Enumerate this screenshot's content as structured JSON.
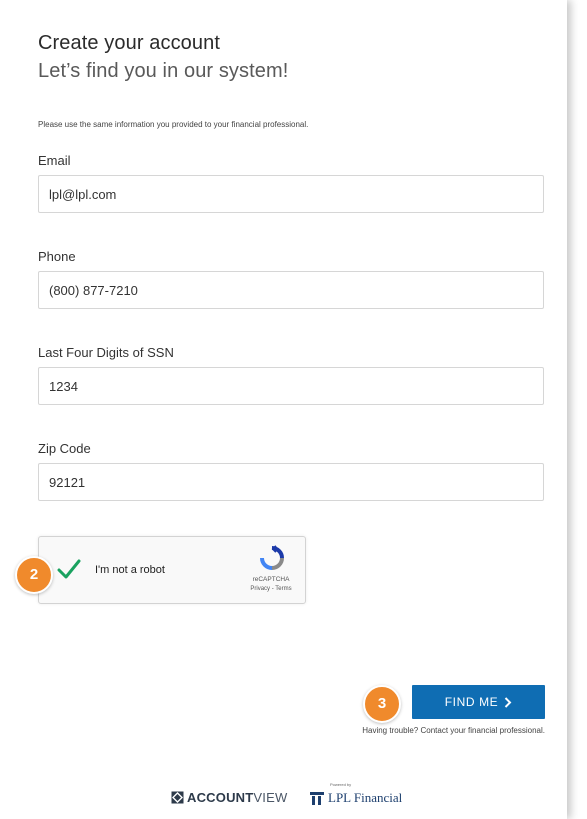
{
  "header": {
    "title": "Create your account",
    "subtitle": "Let’s find you in our system!",
    "instructions": "Please use the same information you provided to your financial professional."
  },
  "form": {
    "email": {
      "label": "Email",
      "value": "lpl@lpl.com"
    },
    "phone": {
      "label": "Phone",
      "value": "(800) 877-7210"
    },
    "ssn": {
      "label": "Last Four Digits of SSN",
      "value": "1234"
    },
    "zip": {
      "label": "Zip Code",
      "value": "92121"
    }
  },
  "recaptcha": {
    "label": "I'm not a robot",
    "checked": true,
    "brand": "reCAPTCHA",
    "terms": "Privacy - Terms"
  },
  "steps": {
    "recaptcha_step": "2",
    "submit_step": "3"
  },
  "actions": {
    "find_me_label": "FIND ME",
    "trouble_text": "Having trouble? Contact your financial professional."
  },
  "footer": {
    "accountview_bold": "ACCOUNT",
    "accountview_light": "VIEW",
    "powered_by": "Powered by",
    "lpl_name": "LPL Financial"
  },
  "colors": {
    "primary_button": "#0f6db3",
    "step_badge": "#f08a2c",
    "check_green": "#1aa260"
  }
}
